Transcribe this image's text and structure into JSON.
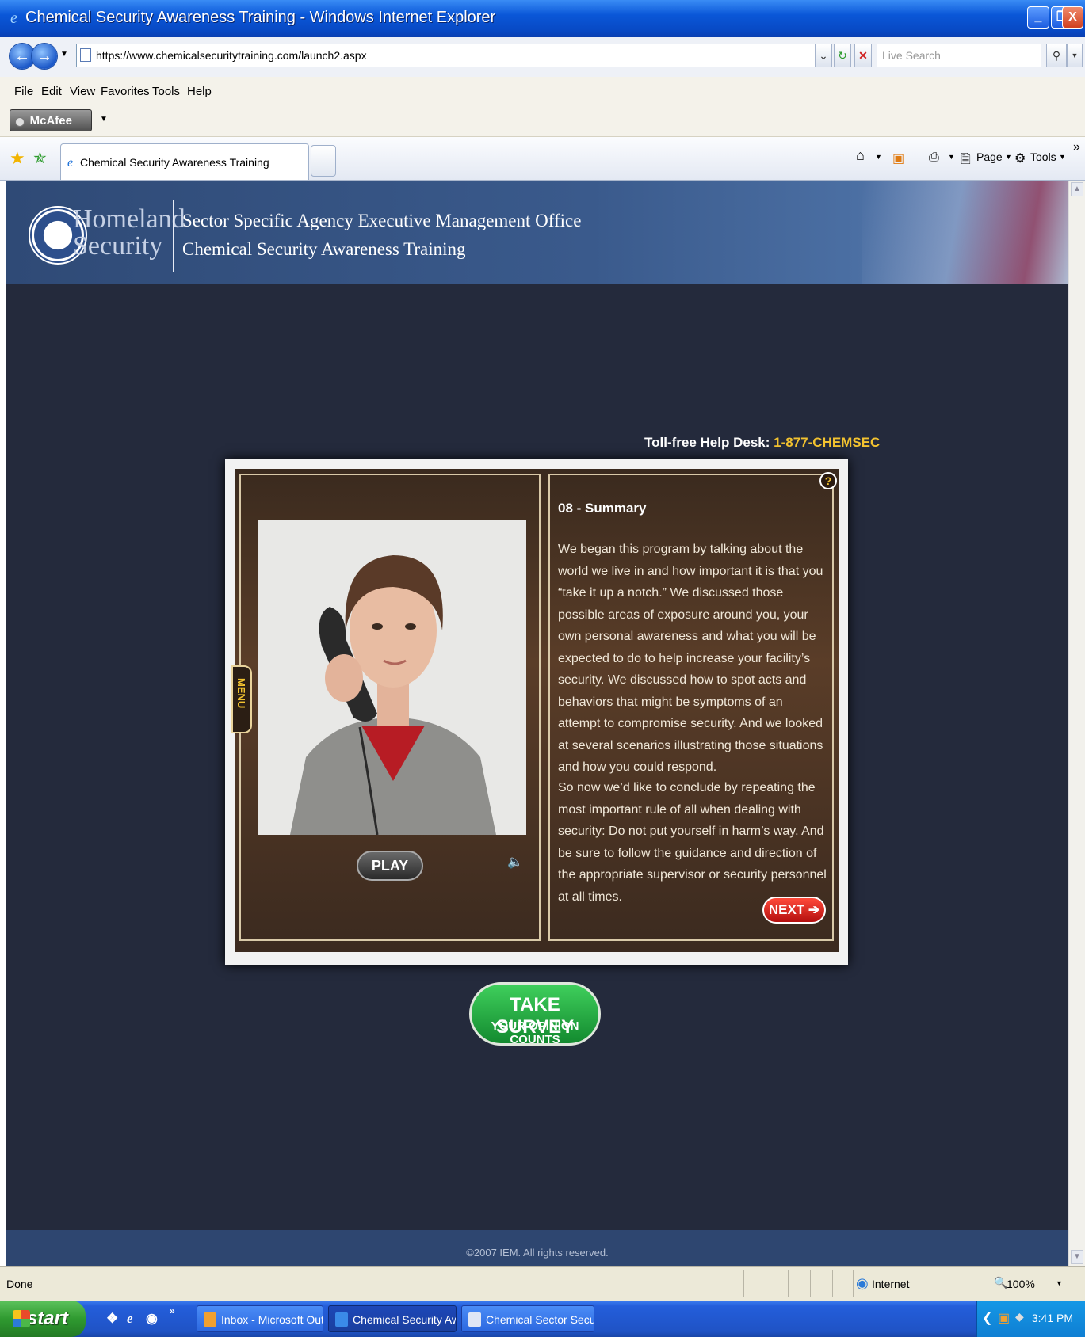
{
  "window": {
    "title": "Chemical Security Awareness Training - Windows Internet Explorer",
    "buttons": [
      "_",
      "❐",
      "X"
    ]
  },
  "address_bar": {
    "url": "https://www.chemicalsecuritytraining.com/launch2.aspx",
    "search_placeholder": "Live Search"
  },
  "menu": {
    "items": [
      "File",
      "Edit",
      "View",
      "Favorites",
      "Tools",
      "Help"
    ]
  },
  "mcafee": {
    "label": "McAfee"
  },
  "tabs": {
    "active_label": "Chemical Security Awareness Training",
    "page_label": "Page",
    "tools_label": "Tools"
  },
  "site": {
    "logo_line1": "Homeland",
    "logo_line2": "Security",
    "header_line1": "Sector Specific Agency Executive Management Office",
    "header_line2": "Chemical Security Awareness Training",
    "helpdesk_label": "Toll-free Help Desk:",
    "helpdesk_number": "1-877-CHEMSEC",
    "copyright": "©2007 IEM. All rights reserved."
  },
  "player": {
    "menu_tab": "MENU",
    "play_label": "PLAY",
    "help_label": "?",
    "section_title": "08 - Summary",
    "paragraph1": "We began this program by talking about the world we live in and how important it is that you “take it up a notch.”  We discussed those possible areas of exposure around you, your own personal awareness and what you will be expected to do to help increase your facility’s security. We discussed how to spot acts and behaviors that might be symptoms of an attempt to compromise security. And we looked at several scenarios illustrating those situations and how you could respond.",
    "paragraph2": "So now we’d like to conclude by repeating the most important rule of all when dealing with security: Do not put yourself in harm’s way. And be sure to follow the guidance and direction of the appropriate supervisor or security personnel at all times.",
    "next_label": "NEXT"
  },
  "survey": {
    "line1": "TAKE SURVEY",
    "line2": "YOUR OPINION COUNTS"
  },
  "status": {
    "text": "Done",
    "zone": "Internet",
    "zoom": "100%"
  },
  "taskbar": {
    "start": "start",
    "items": [
      {
        "label": "Inbox - Microsoft Out...",
        "active": false
      },
      {
        "label": "Chemical Security Aw...",
        "active": true
      },
      {
        "label": "Chemical Sector Secu...",
        "active": false
      }
    ],
    "clock": "3:41 PM"
  },
  "colors": {
    "page_bg": "#242a3c",
    "header_bg": "#3a5a8c",
    "accent_yellow": "#f2c230",
    "next_red": "#d01a14",
    "survey_green": "#27a843"
  }
}
